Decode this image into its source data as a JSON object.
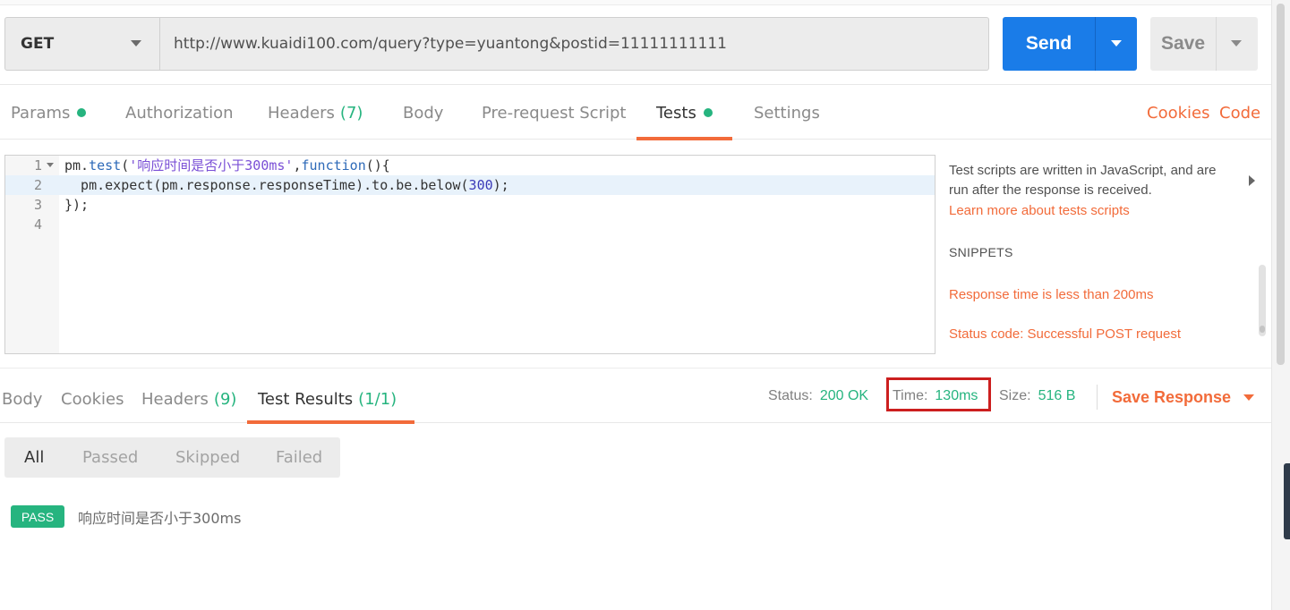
{
  "request": {
    "method": "GET",
    "url": "http://www.kuaidi100.com/query?type=yuantong&postid=11111111111",
    "send_label": "Send",
    "save_label": "Save"
  },
  "request_tabs": {
    "params": "Params",
    "authorization": "Authorization",
    "headers": "Headers",
    "headers_count": "(7)",
    "body": "Body",
    "prerequest": "Pre-request Script",
    "tests": "Tests",
    "settings": "Settings",
    "cookies": "Cookies",
    "code": "Code",
    "active": "Tests"
  },
  "editor": {
    "lines": [
      {
        "num": "1",
        "p1": "pm.",
        "fn": "test",
        "p2": "(",
        "str": "'响应时间是否小于300ms'",
        "p3": ",",
        "kw": "function",
        "p4": "(){"
      },
      {
        "num": "2",
        "pre": "  pm.expect(pm.response.responseTime).to.be.below(",
        "numlit": "300",
        "post": ");"
      },
      {
        "num": "3",
        "text": "});"
      },
      {
        "num": "4",
        "text": ""
      }
    ]
  },
  "side_panel": {
    "description": "Test scripts are written in JavaScript, and are run after the response is received.",
    "learn_more": "Learn more about tests scripts",
    "snippets_heading": "SNIPPETS",
    "snippets": [
      "Response time is less than 200ms",
      "Status code: Successful POST request"
    ]
  },
  "response_tabs": {
    "body": "Body",
    "cookies": "Cookies",
    "headers": "Headers",
    "headers_count": "(9)",
    "test_results": "Test Results",
    "test_results_count": "(1/1)",
    "active": "Test Results"
  },
  "response_meta": {
    "status_label": "Status:",
    "status_value": "200 OK",
    "time_label": "Time:",
    "time_value": "130ms",
    "size_label": "Size:",
    "size_value": "516 B",
    "save_response": "Save Response"
  },
  "filters": {
    "items": [
      "All",
      "Passed",
      "Skipped",
      "Failed"
    ],
    "active": "All"
  },
  "results": [
    {
      "status": "PASS",
      "name": "响应时间是否小于300ms"
    }
  ],
  "colors": {
    "accent": "#f26b3a",
    "primary": "#1a7ce8",
    "success": "#26b47f",
    "highlight_box": "#cc1f1f"
  }
}
